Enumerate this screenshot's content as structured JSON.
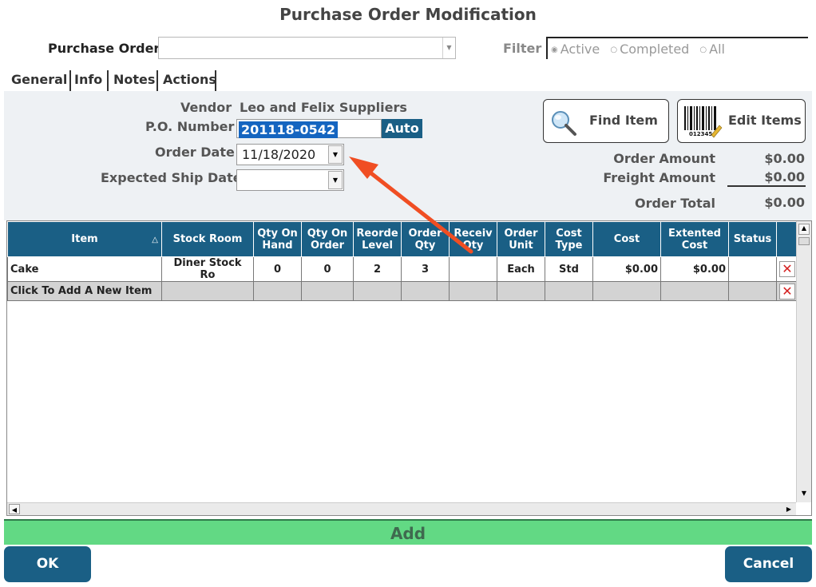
{
  "window": {
    "title": "Purchase Order Modification"
  },
  "purchase_order": {
    "label": "Purchase Order",
    "value": ""
  },
  "filter": {
    "label": "Filter",
    "options": [
      "Active",
      "Completed",
      "All"
    ],
    "selected": "Active"
  },
  "tabs": [
    {
      "label": "General",
      "active": true
    },
    {
      "label": "Info"
    },
    {
      "label": "Notes"
    },
    {
      "label": "Actions"
    }
  ],
  "general": {
    "vendor_label": "Vendor",
    "vendor_value": "Leo and Felix Suppliers",
    "po_number_label": "P.O. Number",
    "po_number_value": "201118-0542",
    "auto_label": "Auto",
    "order_date_label": "Order Date",
    "order_date_value": "11/18/2020",
    "ship_date_label": "Expected Ship Date",
    "ship_date_value": ""
  },
  "buttons": {
    "find_item": "Find Item",
    "edit_items": "Edit Items",
    "add": "Add",
    "ok": "OK",
    "cancel": "Cancel"
  },
  "amounts": {
    "order_amount_label": "Order Amount",
    "order_amount_value": "$0.00",
    "freight_label": "Freight Amount",
    "freight_value": "$0.00",
    "total_label": "Order Total",
    "total_value": "$0.00"
  },
  "grid": {
    "columns": [
      "Item",
      "Stock Room",
      "Qty On Hand",
      "Qty On Order",
      "Reorde Level",
      "Order Qty",
      "Receiv Qty",
      "Order Unit",
      "Cost Type",
      "Cost",
      "Extented Cost",
      "Status"
    ],
    "rows": [
      {
        "item": "Cake",
        "stock_room": "Diner Stock Ro",
        "qty_on_hand": "0",
        "qty_on_order": "0",
        "reorder_level": "2",
        "order_qty": "3",
        "receive_qty": "",
        "order_unit": "Each",
        "cost_type": "Std",
        "cost": "$0.00",
        "extended_cost": "$0.00",
        "status": ""
      }
    ],
    "new_item_text": "Click To Add A New Item"
  },
  "colors": {
    "header_blue": "#1a5f85",
    "add_green": "#62d984",
    "annotation_arrow": "#f04e23"
  }
}
